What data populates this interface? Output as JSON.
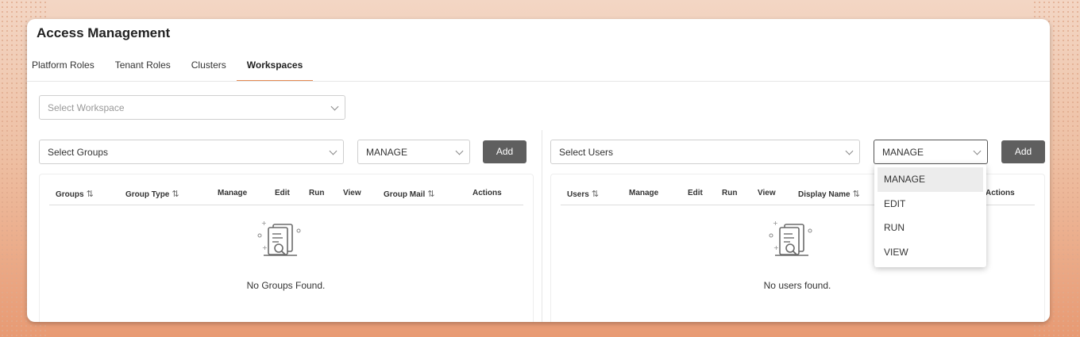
{
  "header": {
    "title": "Access Management"
  },
  "tabs": [
    {
      "label": "Platform Roles"
    },
    {
      "label": "Tenant Roles"
    },
    {
      "label": "Clusters"
    },
    {
      "label": "Workspaces",
      "active": true
    }
  ],
  "workspace_select": {
    "placeholder": "Select Workspace"
  },
  "groups": {
    "select_placeholder": "Select Groups",
    "permission_value": "MANAGE",
    "add_label": "Add",
    "columns": [
      "Groups",
      "Group Type",
      "Manage",
      "Edit",
      "Run",
      "View",
      "Group Mail",
      "Actions"
    ],
    "empty_text": "No Groups Found."
  },
  "users": {
    "select_placeholder": "Select Users",
    "permission_value": "MANAGE",
    "add_label": "Add",
    "columns": [
      "Users",
      "Manage",
      "Edit",
      "Run",
      "View",
      "Display Name",
      "Actions"
    ],
    "empty_text": "No users found."
  },
  "permission_menu": {
    "options": [
      "MANAGE",
      "EDIT",
      "RUN",
      "VIEW"
    ],
    "selected": "MANAGE"
  },
  "icons": {
    "sort": "sort-icon",
    "chevron": "chevron-down-icon",
    "empty": "empty-document-search-icon"
  },
  "colors": {
    "accent": "#e48a55",
    "button": "#5f5f5f"
  }
}
